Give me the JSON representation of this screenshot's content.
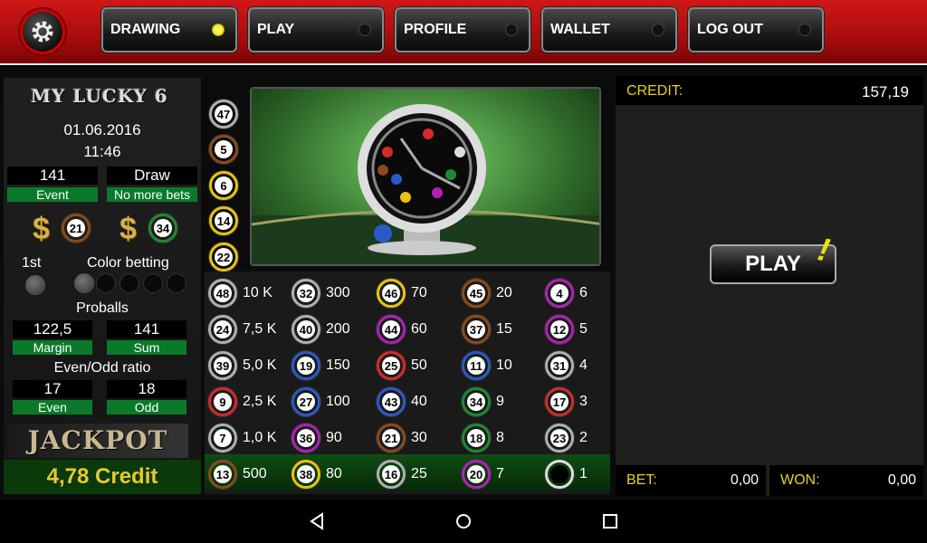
{
  "nav": {
    "items": [
      {
        "label": "DRAWING",
        "active": true
      },
      {
        "label": "PLAY",
        "active": false
      },
      {
        "label": "PROFILE",
        "active": false
      },
      {
        "label": "WALLET",
        "active": false
      },
      {
        "label": "LOG OUT",
        "active": false
      }
    ],
    "settings_icon": "gear-icon"
  },
  "left": {
    "title": "MY LUCKY 6",
    "date": "01.06.2016",
    "time": "11:46",
    "event_value": "141",
    "event_label": "Event",
    "draw_value": "Draw",
    "draw_label": "No more bets",
    "bonus_ball_1": "21",
    "bonus_ball_2": "34",
    "first_label": "1st",
    "color_betting_label": "Color betting",
    "proballs_label": "Proballs",
    "margin_value": "122,5",
    "margin_label": "Margin",
    "sum_value": "141",
    "sum_label": "Sum",
    "evenodd_label": "Even/Odd ratio",
    "even_value": "17",
    "even_label": "Even",
    "odd_value": "18",
    "odd_label": "Odd",
    "jackpot_label": "JACKPOT",
    "jackpot_value": "4,78 Credit"
  },
  "drawn_column": [
    "47",
    "5",
    "6",
    "14",
    "22"
  ],
  "odds_rows": [
    [
      {
        "n": "48",
        "o": "10 K"
      },
      {
        "n": "32",
        "o": "300"
      },
      {
        "n": "46",
        "o": "70"
      },
      {
        "n": "45",
        "o": "20"
      },
      {
        "n": "4",
        "o": "6"
      }
    ],
    [
      {
        "n": "24",
        "o": "7,5 K"
      },
      {
        "n": "40",
        "o": "200"
      },
      {
        "n": "44",
        "o": "60"
      },
      {
        "n": "37",
        "o": "15"
      },
      {
        "n": "12",
        "o": "5"
      }
    ],
    [
      {
        "n": "39",
        "o": "5,0 K"
      },
      {
        "n": "19",
        "o": "150"
      },
      {
        "n": "25",
        "o": "50"
      },
      {
        "n": "11",
        "o": "10"
      },
      {
        "n": "31",
        "o": "4"
      }
    ],
    [
      {
        "n": "9",
        "o": "2,5 K"
      },
      {
        "n": "27",
        "o": "100"
      },
      {
        "n": "43",
        "o": "40"
      },
      {
        "n": "34",
        "o": "9"
      },
      {
        "n": "17",
        "o": "3"
      }
    ],
    [
      {
        "n": "7",
        "o": "1,0 K"
      },
      {
        "n": "36",
        "o": "90"
      },
      {
        "n": "21",
        "o": "30"
      },
      {
        "n": "18",
        "o": "8"
      },
      {
        "n": "23",
        "o": "2"
      }
    ],
    [
      {
        "n": "13",
        "o": "500"
      },
      {
        "n": "38",
        "o": "80"
      },
      {
        "n": "16",
        "o": "25"
      },
      {
        "n": "20",
        "o": "7"
      },
      {
        "n": "",
        "o": "1"
      }
    ]
  ],
  "right": {
    "credit_label": "CREDIT:",
    "credit_value": "157,19",
    "play_label": "PLAY",
    "play_exclaim": "!",
    "bet_label": "BET:",
    "bet_value": "0,00",
    "won_label": "WON:",
    "won_value": "0,00"
  },
  "colors": {
    "red": "#d42a2a",
    "yellow": "#e8c410",
    "green": "#1e8a2e",
    "blue": "#2a5ac8",
    "brown": "#8a4a1a",
    "purple": "#b020b8",
    "black": "#222222",
    "grey": "#b0b0b0"
  },
  "ball_colors": {
    "47": "grey",
    "5": "brown",
    "6": "yellow",
    "14": "yellow",
    "22": "yellow",
    "21": "brown",
    "34": "green",
    "48": "grey",
    "32": "grey",
    "46": "yellow",
    "45": "brown",
    "4": "purple",
    "24": "grey",
    "40": "grey",
    "44": "purple",
    "37": "brown",
    "12": "purple",
    "39": "grey",
    "19": "blue",
    "25": "red",
    "11": "blue",
    "31": "grey",
    "9": "red",
    "27": "blue",
    "43": "blue",
    "17": "red",
    "7": "grey",
    "36": "purple",
    "18": "green",
    "23": "grey",
    "13": "brown",
    "38": "yellow",
    "16": "grey",
    "20": "purple"
  },
  "android_nav": {
    "back_icon": "back-icon",
    "home_icon": "home-icon",
    "recents_icon": "recents-icon"
  }
}
